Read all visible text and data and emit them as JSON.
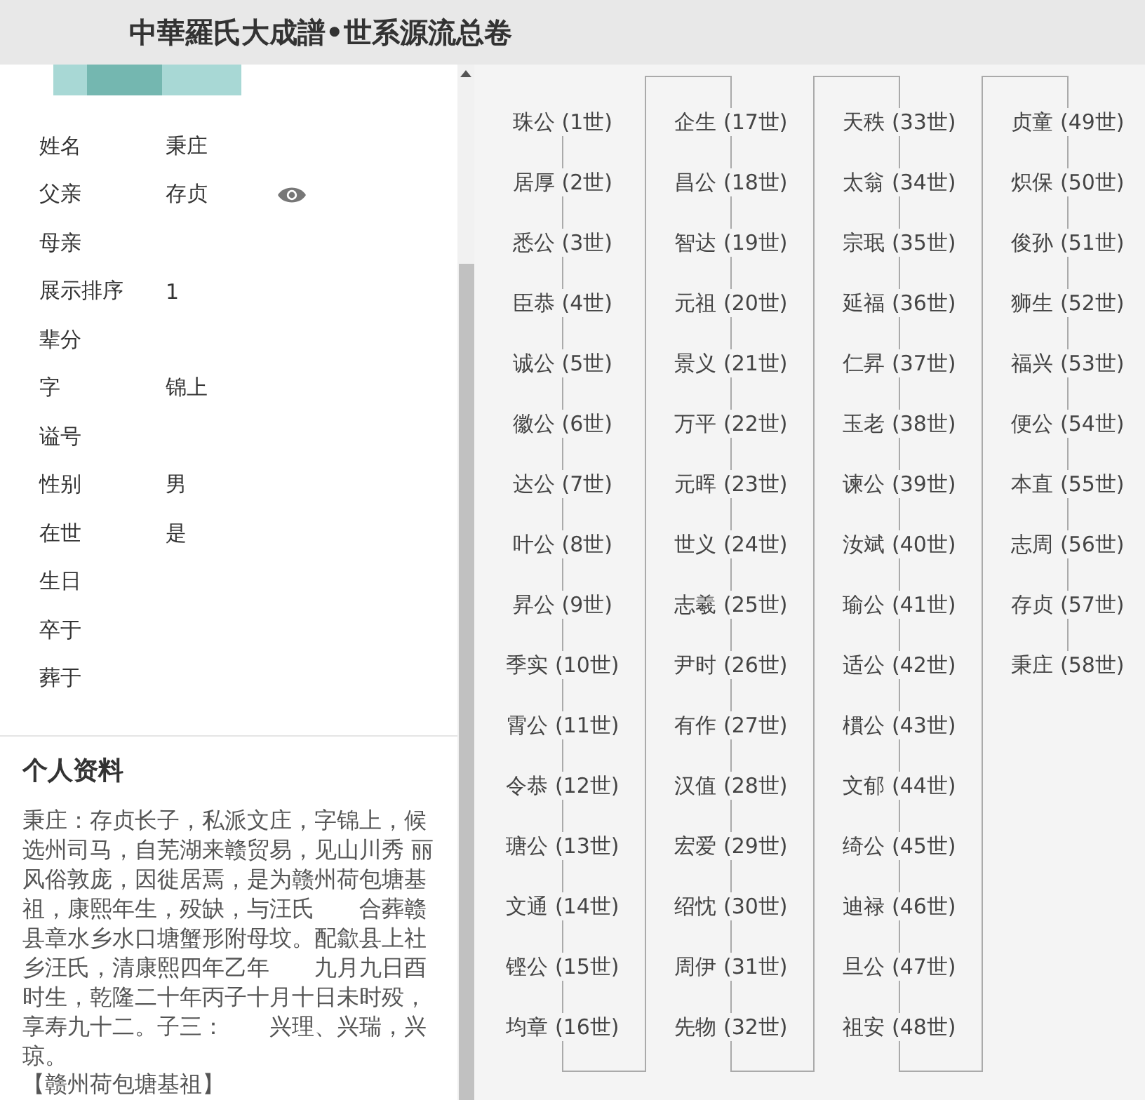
{
  "header": {
    "title": "中華羅氏大成譜•世系源流总卷"
  },
  "profile": {
    "fields": [
      {
        "label": "姓名",
        "value": "秉庄",
        "viewable": false
      },
      {
        "label": "父亲",
        "value": "存贞",
        "viewable": true
      },
      {
        "label": "母亲",
        "viewable": false
      },
      {
        "label": "展示排序",
        "value": "1",
        "viewable": false
      },
      {
        "label": "辈分",
        "viewable": false
      },
      {
        "label": "字",
        "value": "锦上",
        "viewable": false
      },
      {
        "label": "谥号",
        "viewable": false
      },
      {
        "label": "性别",
        "value": "男",
        "viewable": false
      },
      {
        "label": "在世",
        "value": "是",
        "viewable": false
      },
      {
        "label": "生日",
        "viewable": false
      },
      {
        "label": "卒于",
        "viewable": false
      },
      {
        "label": "葬于",
        "viewable": false
      }
    ],
    "section_title": "个人资料",
    "biography": "秉庄：存贞长子，私派文庄，字锦上，候选州司马，自芜湖来赣贸易，见山川秀 丽风俗敦庞，因徙居焉，是为赣州荷包塘基祖，康熙年生，殁缺，与汪氏　　合葬赣县章水乡水口塘蟹形附母坟。配歙县上社乡汪氏，清康熙四年乙年　　九月九日酉时生，乾隆二十年丙子十月十日未时殁，享寿九十二。子三：　　兴理、兴瑞，兴琼。",
    "tag": "【赣州荷包塘基祖】"
  },
  "lineage": {
    "columns": [
      [
        "珠公 (1世)",
        "居厚 (2世)",
        "悉公 (3世)",
        "臣恭 (4世)",
        "诚公 (5世)",
        "徽公 (6世)",
        "达公 (7世)",
        "叶公 (8世)",
        "昇公 (9世)",
        "季实 (10世)",
        "霄公 (11世)",
        "令恭 (12世)",
        "瑭公 (13世)",
        "文通 (14世)",
        "铿公 (15世)",
        "均章 (16世)"
      ],
      [
        "企生 (17世)",
        "昌公 (18世)",
        "智达 (19世)",
        "元祖 (20世)",
        "景义 (21世)",
        "万平 (22世)",
        "元晖 (23世)",
        "世义 (24世)",
        "志羲 (25世)",
        "尹时 (26世)",
        "有作 (27世)",
        "汉值 (28世)",
        "宏爱 (29世)",
        "绍忱 (30世)",
        "周伊 (31世)",
        "先物 (32世)"
      ],
      [
        "天秩 (33世)",
        "太翁 (34世)",
        "宗珉 (35世)",
        "延福 (36世)",
        "仁昇 (37世)",
        "玉老 (38世)",
        "谏公 (39世)",
        "汝斌 (40世)",
        "瑜公 (41世)",
        "适公 (42世)",
        "樌公 (43世)",
        "文郁 (44世)",
        "绮公 (45世)",
        "迪禄 (46世)",
        "旦公 (47世)",
        "祖安 (48世)"
      ],
      [
        "贞童 (49世)",
        "炽保 (50世)",
        "俊孙 (51世)",
        "狮生 (52世)",
        "福兴 (53世)",
        "便公 (54世)",
        "本直 (55世)",
        "志周 (56世)",
        "存贞 (57世)",
        "秉庄 (58世)"
      ]
    ]
  }
}
